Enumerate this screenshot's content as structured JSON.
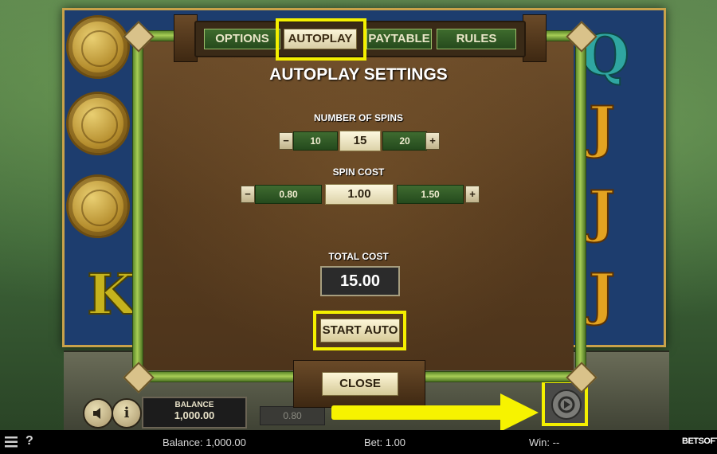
{
  "tabs": [
    {
      "label": "OPTIONS",
      "active": false
    },
    {
      "label": "AUTOPLAY",
      "active": true
    },
    {
      "label": "PAYTABLE",
      "active": false
    },
    {
      "label": "RULES",
      "active": false
    }
  ],
  "panel": {
    "title": "AUTOPLAY SETTINGS",
    "spins": {
      "label": "NUMBER OF SPINS",
      "decrease": "−",
      "increase": "+",
      "options": [
        "10",
        "15",
        "20"
      ],
      "selected": "15"
    },
    "spin_cost": {
      "label": "SPIN COST",
      "decrease": "−",
      "increase": "+",
      "options": [
        "0.80",
        "1.00",
        "1.50"
      ],
      "selected": "1.00"
    },
    "total_cost": {
      "label": "TOTAL COST",
      "value": "15.00"
    },
    "start_button": "START AUTO",
    "close_button": "CLOSE"
  },
  "game": {
    "balance_label": "BALANCE",
    "balance_value": "1,000.00",
    "bet_display": "0.80",
    "sound_icon": "speaker-icon",
    "info_label": "i",
    "autoplay_icon": "autoplay-icon",
    "reel_symbols": [
      "K",
      "Q",
      "J",
      "J",
      "J"
    ]
  },
  "status_bar": {
    "menu_icon": "hamburger-icon",
    "help_label": "?",
    "balance": "Balance: 1,000.00",
    "bet": "Bet: 1.00",
    "win": "Win: --",
    "brand": "BETSOFT"
  },
  "colors": {
    "highlight": "#f4f000",
    "reel_bg": "#1d3d6e",
    "tab_active": "#fbf5d9",
    "tab_inactive": "#2e5a24"
  }
}
